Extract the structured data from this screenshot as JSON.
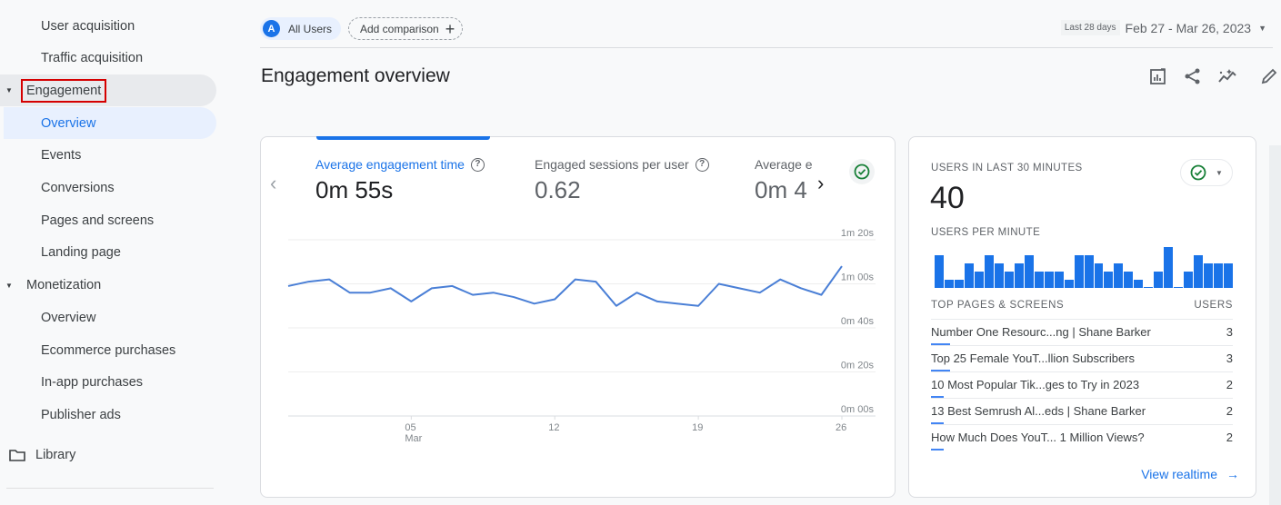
{
  "sidebar": {
    "items": [
      {
        "label": "User acquisition",
        "type": "sub"
      },
      {
        "label": "Traffic acquisition",
        "type": "sub"
      },
      {
        "label": "Engagement",
        "type": "group",
        "highlighted": true
      },
      {
        "label": "Overview",
        "type": "sub",
        "active": true
      },
      {
        "label": "Events",
        "type": "sub"
      },
      {
        "label": "Conversions",
        "type": "sub"
      },
      {
        "label": "Pages and screens",
        "type": "sub"
      },
      {
        "label": "Landing page",
        "type": "sub"
      },
      {
        "label": "Monetization",
        "type": "group"
      },
      {
        "label": "Overview",
        "type": "sub"
      },
      {
        "label": "Ecommerce purchases",
        "type": "sub"
      },
      {
        "label": "In-app purchases",
        "type": "sub"
      },
      {
        "label": "Publisher ads",
        "type": "sub"
      }
    ],
    "library_label": "Library"
  },
  "topbar": {
    "segment_avatar": "A",
    "segment_label": "All Users",
    "add_comparison_label": "Add comparison",
    "date_badge": "Last 28 days",
    "date_range": "Feb 27 - Mar 26, 2023"
  },
  "page": {
    "title": "Engagement overview",
    "toolbar_icons": [
      "customize-report-icon",
      "share-icon",
      "insights-icon",
      "edit-icon"
    ]
  },
  "metrics": [
    {
      "label": "Average engagement time",
      "value": "0m 55s",
      "active": true
    },
    {
      "label": "Engaged sessions per user",
      "value": "0.62"
    },
    {
      "label": "Average e",
      "value": "0m 4"
    }
  ],
  "chart_data": {
    "type": "line",
    "title": "Average engagement time",
    "x": [
      "Feb 27",
      "Feb 28",
      "Mar 01",
      "Mar 02",
      "Mar 03",
      "Mar 04",
      "Mar 05",
      "Mar 06",
      "Mar 07",
      "Mar 08",
      "Mar 09",
      "Mar 10",
      "Mar 11",
      "Mar 12",
      "Mar 13",
      "Mar 14",
      "Mar 15",
      "Mar 16",
      "Mar 17",
      "Mar 18",
      "Mar 19",
      "Mar 20",
      "Mar 21",
      "Mar 22",
      "Mar 23",
      "Mar 24",
      "Mar 25",
      "Mar 26"
    ],
    "series": [
      {
        "name": "Average engagement time (s)",
        "color": "#4a7fd6",
        "values": [
          59,
          61,
          62,
          56,
          56,
          58,
          52,
          58,
          59,
          55,
          56,
          54,
          51,
          53,
          62,
          61,
          50,
          56,
          52,
          51,
          50,
          60,
          58,
          56,
          62,
          58,
          55,
          68
        ]
      }
    ],
    "x_ticks": [
      {
        "index": 6,
        "label": "05",
        "sublabel": "Mar"
      },
      {
        "index": 13,
        "label": "12"
      },
      {
        "index": 20,
        "label": "19"
      },
      {
        "index": 27,
        "label": "26"
      }
    ],
    "y_ticks": [
      {
        "value": 80,
        "label": "1m 20s"
      },
      {
        "value": 60,
        "label": "1m 00s"
      },
      {
        "value": 40,
        "label": "0m 40s"
      },
      {
        "value": 20,
        "label": "0m 20s"
      },
      {
        "value": 0,
        "label": "0m 00s"
      }
    ],
    "ylim": [
      0,
      80
    ],
    "grid": true,
    "xlabel": "",
    "ylabel": ""
  },
  "realtime": {
    "users_label": "USERS IN LAST 30 MINUTES",
    "users_value": "40",
    "per_minute_label": "USERS PER MINUTE",
    "per_minute": [
      4,
      1,
      1,
      3,
      2,
      4,
      3,
      2,
      3,
      4,
      2,
      2,
      2,
      1,
      4,
      4,
      3,
      2,
      3,
      2,
      1,
      0,
      2,
      5,
      0,
      2,
      4,
      3,
      3,
      3
    ],
    "top_pages_label": "TOP PAGES & SCREENS",
    "users_col_label": "USERS",
    "top_pages": [
      {
        "title": "Number One Resourc...ng | Shane Barker",
        "users": "3",
        "share": 1.0
      },
      {
        "title": "Top 25 Female YouT...llion Subscribers",
        "users": "3",
        "share": 1.0
      },
      {
        "title": "10 Most Popular Tik...ges to Try in 2023",
        "users": "2",
        "share": 0.67
      },
      {
        "title": "13 Best Semrush Al...eds | Shane Barker",
        "users": "2",
        "share": 0.67
      },
      {
        "title": "How Much Does YouT... 1 Million Views?",
        "users": "2",
        "share": 0.67
      }
    ],
    "view_realtime_label": "View realtime"
  },
  "colors": {
    "accent": "#1a73e8",
    "check": "#188038",
    "highlight_box": "#d50000"
  }
}
